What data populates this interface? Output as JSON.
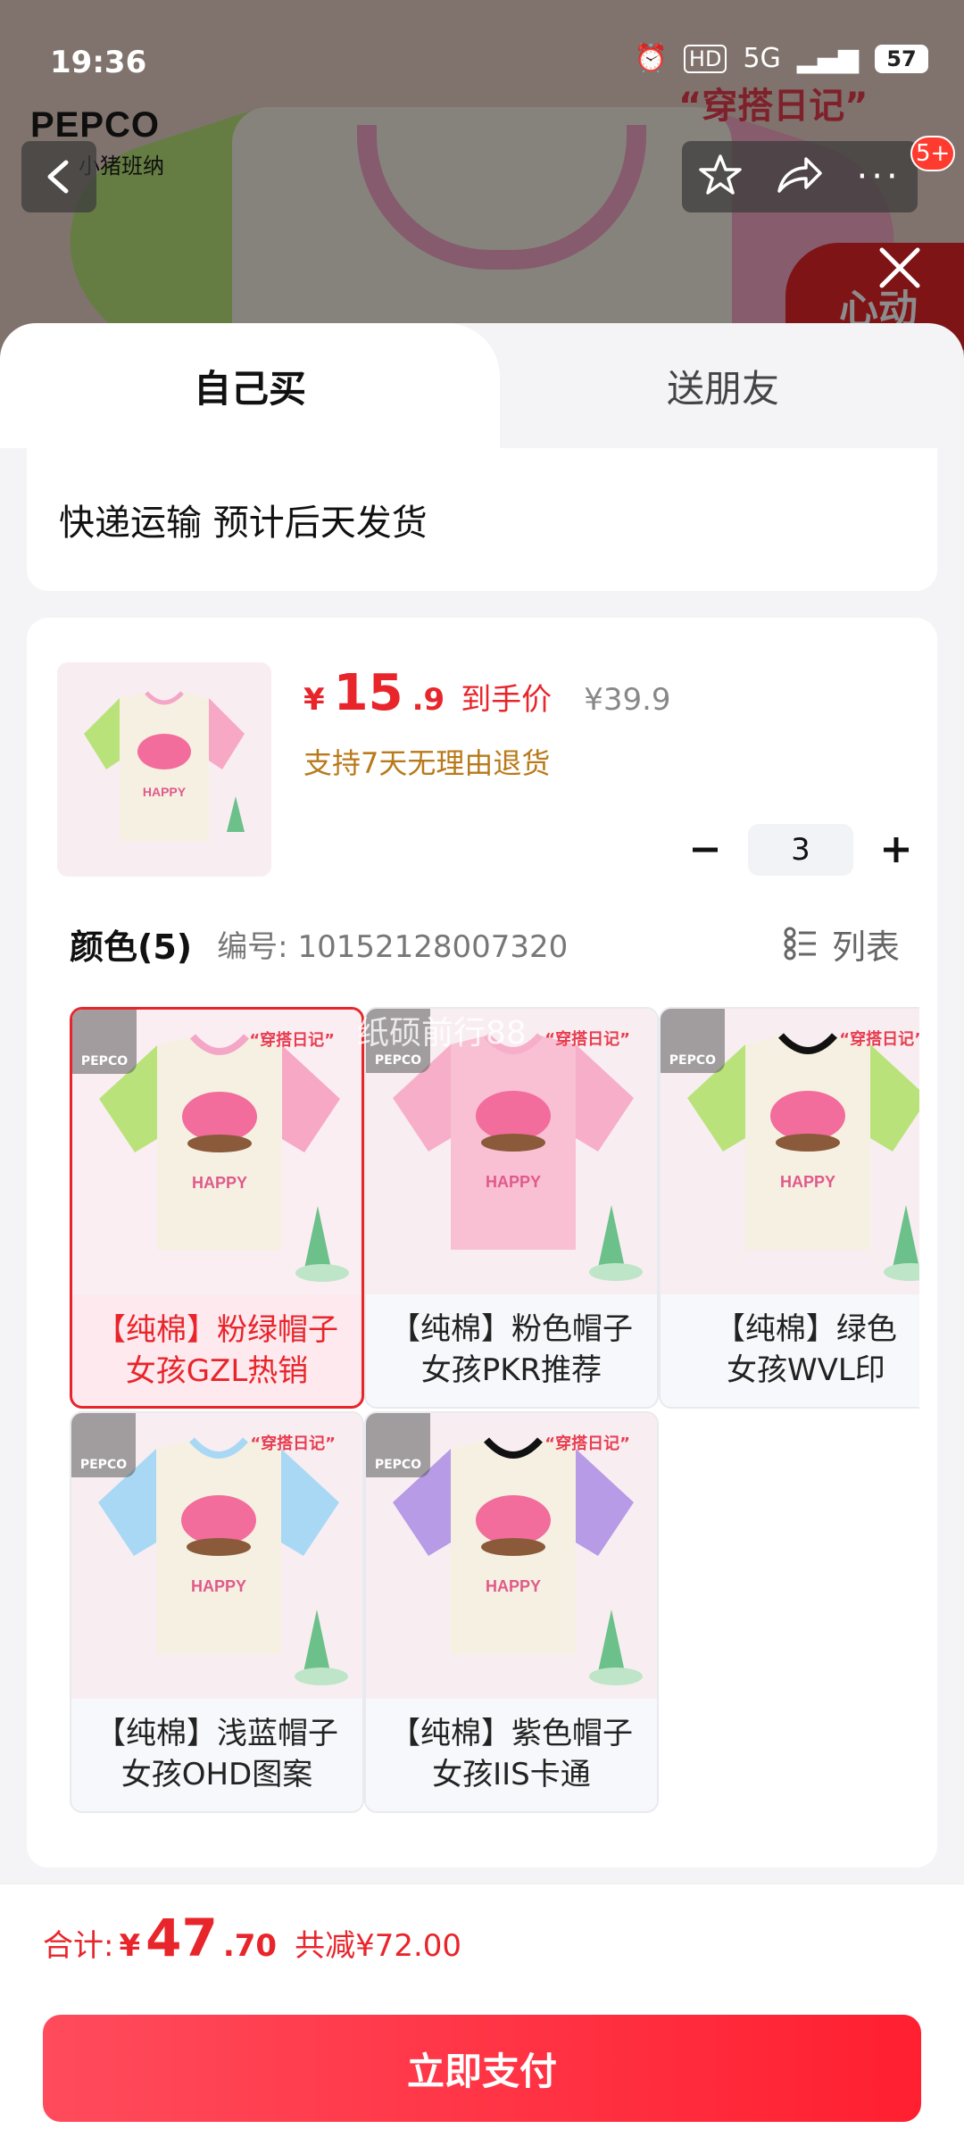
{
  "status_bar": {
    "time": "19:36",
    "network": "5G",
    "battery": "57"
  },
  "background": {
    "brand": "PEPCO",
    "brand_sub": "小猪班纳",
    "title": "“穿搭日记”",
    "tag": "心动"
  },
  "nav": {
    "badge": "5+"
  },
  "tabs": {
    "own": "自己买",
    "gift": "送朋友"
  },
  "delivery": {
    "text": "快递运输 预计后天发货"
  },
  "product": {
    "currency": "¥",
    "price_int": "15",
    "price_dec": ".9",
    "price_tag": "到手价",
    "original_price": "¥39.9",
    "return_policy": "支持7天无理由退货",
    "quantity": "3"
  },
  "colors": {
    "title": "颜色(5)",
    "code": "编号: 10152128007320",
    "list_label": "列表",
    "items": [
      {
        "label": "【纯棉】粉绿帽子\n女孩GZL热销",
        "sleeve": "#b9e37a",
        "sleeve2": "#f6a8c5",
        "body": "#f6f0e2",
        "collar": "#f4a6c6"
      },
      {
        "label": "【纯棉】粉色帽子\n女孩PKR推荐",
        "sleeve": "#f7afc9",
        "sleeve2": "#f7afc9",
        "body": "#f9bfd3",
        "collar": "#f7afc9"
      },
      {
        "label": "【纯棉】绿色\n女孩WVL印",
        "sleeve": "#b9e37a",
        "sleeve2": "#b9e37a",
        "body": "#f6f0e2",
        "collar": "#111111"
      },
      {
        "label": "【纯棉】浅蓝帽子\n女孩OHD图案",
        "sleeve": "#a9d8f5",
        "sleeve2": "#a9d8f5",
        "body": "#f6f0e2",
        "collar": "#a9d8f5"
      },
      {
        "label": "【纯棉】紫色帽子\n女孩IIS卡通",
        "sleeve": "#b79be6",
        "sleeve2": "#b79be6",
        "body": "#f6f0e2",
        "collar": "#111111"
      }
    ],
    "image_logo": "PEPCO",
    "image_tag": "“穿搭日记”"
  },
  "watermark": "纸硕前行88",
  "footer": {
    "total_label": "合计:",
    "currency": "¥",
    "total_int": "47",
    "total_dec": ".70",
    "saved": "共减¥72.00",
    "pay_label": "立即支付"
  },
  "colors_theme": {
    "accent": "#e8252b",
    "gold": "#b87a1a"
  }
}
